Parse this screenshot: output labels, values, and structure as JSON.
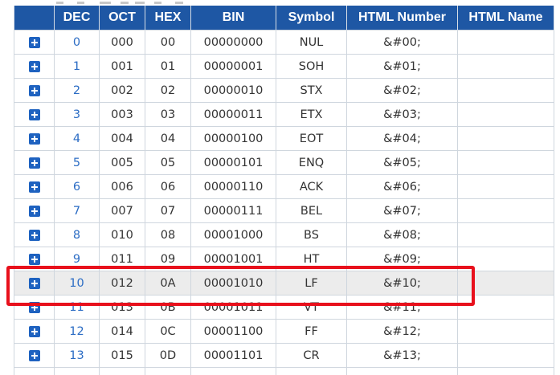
{
  "table": {
    "headers": [
      "",
      "DEC",
      "OCT",
      "HEX",
      "BIN",
      "Symbol",
      "HTML Number",
      "HTML Name"
    ],
    "rows": [
      {
        "dec": "0",
        "oct": "000",
        "hex": "00",
        "bin": "00000000",
        "symbol": "NUL",
        "html_number": "&#00;",
        "html_name": ""
      },
      {
        "dec": "1",
        "oct": "001",
        "hex": "01",
        "bin": "00000001",
        "symbol": "SOH",
        "html_number": "&#01;",
        "html_name": ""
      },
      {
        "dec": "2",
        "oct": "002",
        "hex": "02",
        "bin": "00000010",
        "symbol": "STX",
        "html_number": "&#02;",
        "html_name": ""
      },
      {
        "dec": "3",
        "oct": "003",
        "hex": "03",
        "bin": "00000011",
        "symbol": "ETX",
        "html_number": "&#03;",
        "html_name": ""
      },
      {
        "dec": "4",
        "oct": "004",
        "hex": "04",
        "bin": "00000100",
        "symbol": "EOT",
        "html_number": "&#04;",
        "html_name": ""
      },
      {
        "dec": "5",
        "oct": "005",
        "hex": "05",
        "bin": "00000101",
        "symbol": "ENQ",
        "html_number": "&#05;",
        "html_name": ""
      },
      {
        "dec": "6",
        "oct": "006",
        "hex": "06",
        "bin": "00000110",
        "symbol": "ACK",
        "html_number": "&#06;",
        "html_name": ""
      },
      {
        "dec": "7",
        "oct": "007",
        "hex": "07",
        "bin": "00000111",
        "symbol": "BEL",
        "html_number": "&#07;",
        "html_name": ""
      },
      {
        "dec": "8",
        "oct": "010",
        "hex": "08",
        "bin": "00001000",
        "symbol": "BS",
        "html_number": "&#08;",
        "html_name": ""
      },
      {
        "dec": "9",
        "oct": "011",
        "hex": "09",
        "bin": "00001001",
        "symbol": "HT",
        "html_number": "&#09;",
        "html_name": ""
      },
      {
        "dec": "10",
        "oct": "012",
        "hex": "0A",
        "bin": "00001010",
        "symbol": "LF",
        "html_number": "&#10;",
        "html_name": "",
        "highlighted": true
      },
      {
        "dec": "11",
        "oct": "013",
        "hex": "0B",
        "bin": "00001011",
        "symbol": "VT",
        "html_number": "&#11;",
        "html_name": ""
      },
      {
        "dec": "12",
        "oct": "014",
        "hex": "0C",
        "bin": "00001100",
        "symbol": "FF",
        "html_number": "&#12;",
        "html_name": ""
      },
      {
        "dec": "13",
        "oct": "015",
        "hex": "0D",
        "bin": "00001101",
        "symbol": "CR",
        "html_number": "&#13;",
        "html_name": ""
      },
      {
        "dec": "",
        "oct": "",
        "hex": "",
        "bin": "",
        "symbol": "",
        "html_number": "",
        "html_name": ""
      }
    ]
  },
  "row_icon": "plus-square-icon",
  "colors": {
    "header_bg": "#1e57a4",
    "header_text": "#ffffff",
    "dec_link": "#2b6cc4",
    "plus_icon": "#1e62c0",
    "highlight_border": "#e8101c",
    "highlight_row_bg": "#ececec"
  }
}
